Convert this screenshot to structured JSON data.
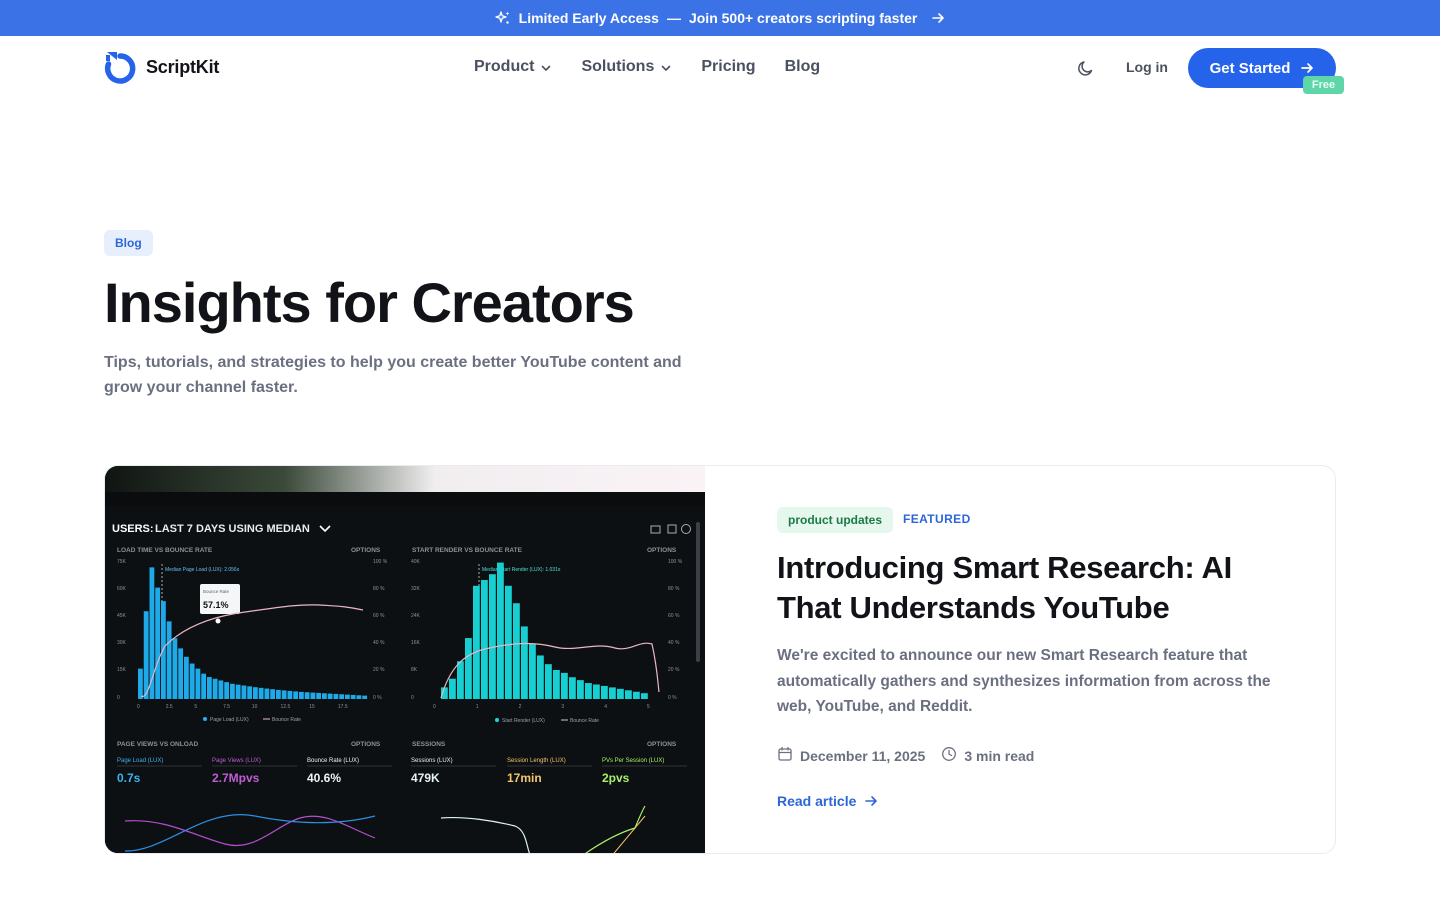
{
  "announcement": {
    "highlight": "Limited Early Access",
    "separator": "—",
    "text": "Join 500+ creators scripting faster",
    "bg_color": "#3b73e6"
  },
  "nav": {
    "brand": "ScriptKit",
    "items": [
      {
        "label": "Product",
        "has_dropdown": true
      },
      {
        "label": "Solutions",
        "has_dropdown": true
      },
      {
        "label": "Pricing",
        "has_dropdown": false
      },
      {
        "label": "Blog",
        "has_dropdown": false
      }
    ],
    "theme_icon": "moon-icon",
    "login_label": "Log in",
    "cta_label": "Get Started",
    "cta_badge": "Free",
    "accent_color": "#2563eb"
  },
  "hero": {
    "tag": "Blog",
    "title": "Insights for Creators",
    "subtitle": "Tips, tutorials, and strategies to help you create better YouTube content and grow your channel faster."
  },
  "featured_post": {
    "category": "product updates",
    "label": "FEATURED",
    "title": "Introducing Smart Research: AI That Understands YouTube",
    "excerpt": "We're excited to announce our new Smart Research feature that automatically gathers and synthesizes information from across the web, YouTube, and Reddit.",
    "date": "December 11, 2025",
    "read_time": "3 min read",
    "read_more": "Read article",
    "image": {
      "header_prefix": "USERS:",
      "header_text": "LAST 7 DAYS USING MEDIAN",
      "panel_titles": [
        "LOAD TIME VS BOUNCE RATE",
        "START RENDER VS BOUNCE RATE",
        "PAGE VIEWS VS ONLOAD",
        "SESSIONS"
      ],
      "options_label": "OPTIONS",
      "tooltip_label": "Bounce Rate",
      "tooltip_value": "57.1%",
      "median_left": "Median Page Load (LUX): 2.056s",
      "median_right": "Median Start Render (LUX): 1.031s",
      "legend_left": [
        "Page Load (LUX)",
        "Bounce Rate"
      ],
      "legend_right": [
        "Start Render (LUX)",
        "Bounce Rate"
      ],
      "stats_left": [
        {
          "label": "Page Load (LUX)",
          "value": "0.7s"
        },
        {
          "label": "Page Views (LUX)",
          "value": "2.7Mpvs"
        },
        {
          "label": "Bounce Rate (LUX)",
          "value": "40.6%"
        }
      ],
      "stats_right": [
        {
          "label": "Sessions (LUX)",
          "value": "479K"
        },
        {
          "label": "Session Length (LUX)",
          "value": "17min"
        },
        {
          "label": "PVs Per Session (LUX)",
          "value": "2pvs"
        }
      ],
      "left_y_ticks": [
        "75K",
        "60K",
        "45K",
        "30K",
        "15K",
        "0"
      ],
      "left_x_ticks": [
        "0",
        "2.5",
        "5",
        "7.5",
        "10",
        "12.5",
        "15",
        "17.5"
      ],
      "right_y_ticks": [
        "40K",
        "32K",
        "24K",
        "16K",
        "8K",
        "0"
      ],
      "right_x_ticks": [
        "0",
        "1",
        "2",
        "3",
        "4",
        "5"
      ],
      "pct_ticks": [
        "100 %",
        "80 %",
        "60 %",
        "40 %",
        "20 %",
        "0 %"
      ],
      "bars_left": [
        18,
        52,
        78,
        66,
        58,
        46,
        36,
        30,
        25,
        21,
        18,
        15,
        13,
        12,
        11,
        10,
        9,
        8.5,
        8,
        7.5,
        7,
        6.6,
        6.2,
        5.8,
        5.4,
        5.1,
        4.8,
        4.5,
        4.2,
        4,
        3.8,
        3.6,
        3.4,
        3.2,
        3,
        2.8,
        2.6,
        2.4,
        2.2,
        2
      ],
      "bars_right": [
        8,
        14,
        26,
        42,
        78,
        82,
        86,
        94,
        78,
        66,
        50,
        38,
        30,
        24,
        20,
        18,
        15,
        13,
        11,
        10,
        9,
        8,
        7,
        6,
        5,
        4
      ]
    }
  }
}
